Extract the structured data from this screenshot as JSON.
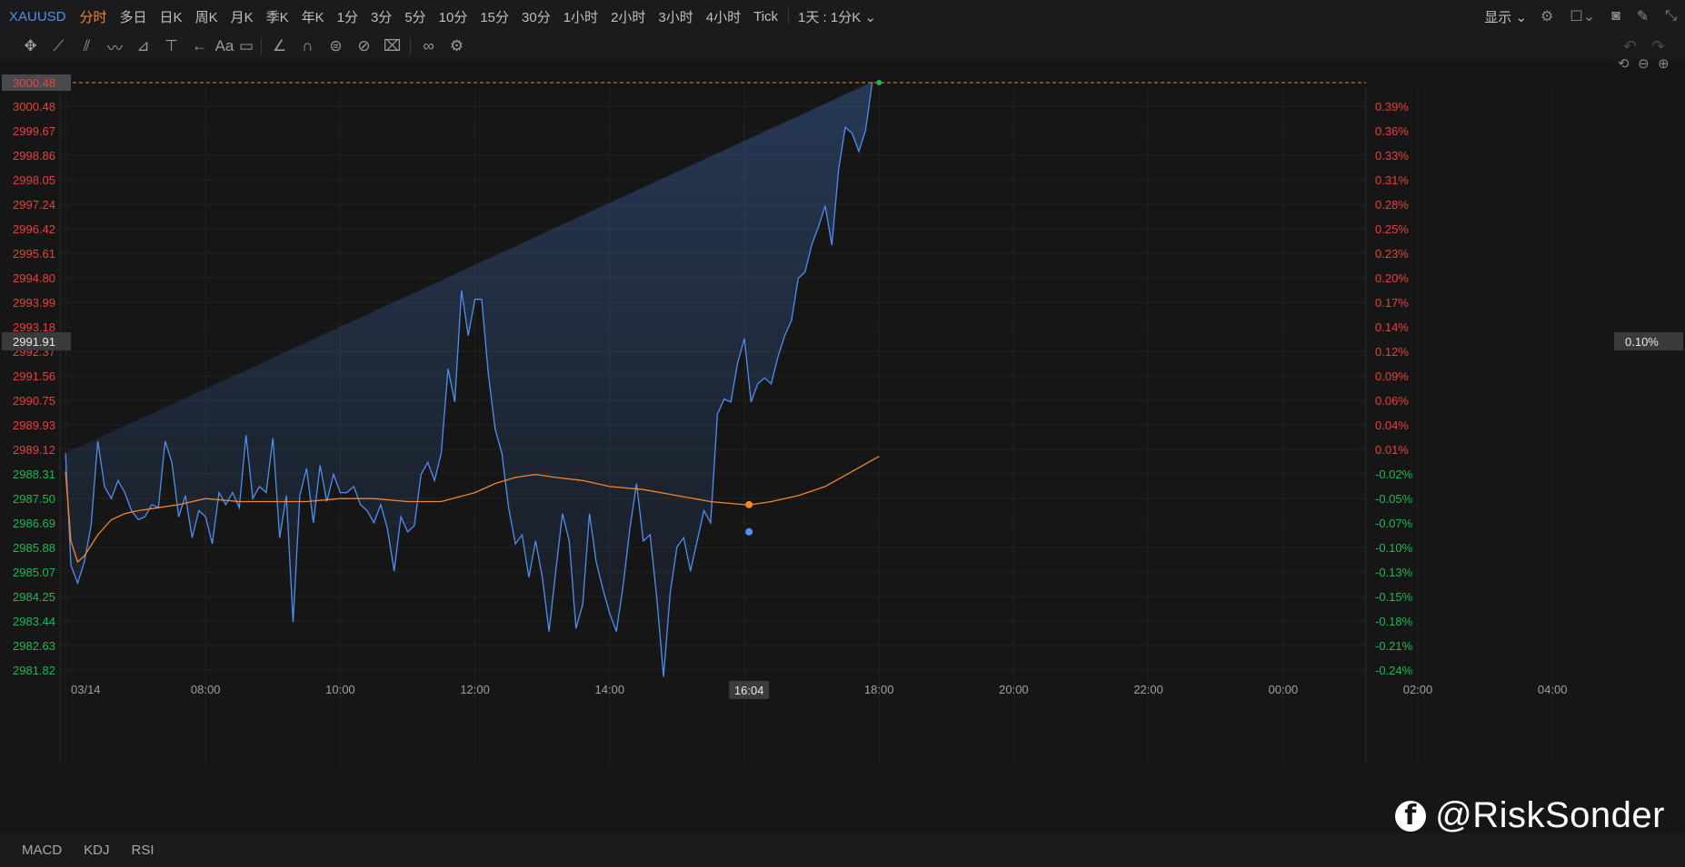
{
  "topbar": {
    "symbol": "XAUUSD",
    "timeframes": [
      {
        "label": "分时",
        "active": true
      },
      {
        "label": "多日"
      },
      {
        "label": "日K"
      },
      {
        "label": "周K"
      },
      {
        "label": "月K"
      },
      {
        "label": "季K"
      },
      {
        "label": "年K"
      },
      {
        "label": "1分"
      },
      {
        "label": "3分"
      },
      {
        "label": "5分"
      },
      {
        "label": "10分"
      },
      {
        "label": "15分"
      },
      {
        "label": "30分"
      },
      {
        "label": "1小时"
      },
      {
        "label": "2小时"
      },
      {
        "label": "3小时"
      },
      {
        "label": "4小时"
      },
      {
        "label": "Tick"
      }
    ],
    "period_dropdown": "1天 : 1分K",
    "display_label": "显示"
  },
  "indicators": [
    "MACD",
    "KDJ",
    "RSI"
  ],
  "watermark": {
    "text": "@RiskSonder",
    "icon": "facebook-icon"
  },
  "chart_data": {
    "type": "line",
    "instrument": "XAUUSD",
    "price_range": [
      2980.7,
      3001.1
    ],
    "pct_range": [
      -0.28,
      0.4
    ],
    "y_ticks_left": [
      "3000.48",
      "2999.67",
      "2998.86",
      "2998.05",
      "2997.24",
      "2996.42",
      "2995.61",
      "2994.80",
      "2993.99",
      "2993.18",
      "2992.37",
      "2991.56",
      "2990.75",
      "2989.93",
      "2989.12",
      "2988.31",
      "2987.50",
      "2986.69",
      "2985.88",
      "2985.07",
      "2984.25",
      "2983.44",
      "2982.63",
      "2981.82"
    ],
    "y_ticks_right": [
      "0.39%",
      "0.36%",
      "0.33%",
      "0.31%",
      "0.28%",
      "0.25%",
      "0.23%",
      "0.20%",
      "0.17%",
      "0.14%",
      "0.12%",
      "0.09%",
      "0.06%",
      "0.04%",
      "0.01%",
      "-0.02%",
      "-0.05%",
      "-0.07%",
      "-0.10%",
      "-0.13%",
      "-0.15%",
      "-0.18%",
      "-0.21%",
      "-0.24%"
    ],
    "up_color": "#e8413c",
    "down_color": "#1db954",
    "price_line_color": "#4f8ff0",
    "avg_line_color": "#f4852b",
    "x_ticks": [
      {
        "label": "03/14",
        "time": 5.92
      },
      {
        "label": "08:00",
        "time": 8.0
      },
      {
        "label": "10:00",
        "time": 10.0
      },
      {
        "label": "12:00",
        "time": 12.0
      },
      {
        "label": "14:00",
        "time": 14.0
      },
      {
        "label": "16:00",
        "time": 16.0
      },
      {
        "label": "18:00",
        "time": 18.0
      },
      {
        "label": "20:00",
        "time": 20.0
      },
      {
        "label": "22:00",
        "time": 22.0
      },
      {
        "label": "00:00",
        "time": 24.0
      },
      {
        "label": "02:00",
        "time": 26.0
      },
      {
        "label": "04:00",
        "time": 28.0
      }
    ],
    "time_range": [
      5.92,
      29.5
    ],
    "crosshair": {
      "time_label": "16:04",
      "time": 16.07,
      "price_label": "2991.91",
      "pct_label": "0.10%",
      "price": 2991.91
    },
    "last_price": {
      "label": "3000.48",
      "value": 3000.48,
      "time": 18.0
    },
    "price_series": {
      "name": "XAUUSD",
      "x": [
        5.92,
        6.0,
        6.1,
        6.2,
        6.3,
        6.4,
        6.5,
        6.6,
        6.7,
        6.8,
        6.9,
        7.0,
        7.1,
        7.2,
        7.3,
        7.4,
        7.5,
        7.6,
        7.7,
        7.8,
        7.9,
        8.0,
        8.1,
        8.2,
        8.3,
        8.4,
        8.5,
        8.6,
        8.7,
        8.8,
        8.9,
        9.0,
        9.1,
        9.2,
        9.3,
        9.4,
        9.5,
        9.6,
        9.7,
        9.8,
        9.9,
        10.0,
        10.1,
        10.2,
        10.3,
        10.4,
        10.5,
        10.6,
        10.7,
        10.8,
        10.9,
        11.0,
        11.1,
        11.2,
        11.3,
        11.4,
        11.5,
        11.6,
        11.7,
        11.8,
        11.9,
        12.0,
        12.1,
        12.2,
        12.3,
        12.4,
        12.5,
        12.6,
        12.7,
        12.8,
        12.9,
        13.0,
        13.1,
        13.2,
        13.3,
        13.4,
        13.5,
        13.6,
        13.7,
        13.8,
        13.9,
        14.0,
        14.1,
        14.2,
        14.3,
        14.4,
        14.5,
        14.6,
        14.7,
        14.8,
        14.9,
        15.0,
        15.1,
        15.2,
        15.3,
        15.4,
        15.5,
        15.6,
        15.7,
        15.8,
        15.9,
        16.0,
        16.1,
        16.2,
        16.3,
        16.4,
        16.5,
        16.6,
        16.7,
        16.8,
        16.9,
        17.0,
        17.1,
        17.2,
        17.3,
        17.4,
        17.5,
        17.6,
        17.7,
        17.8,
        17.9,
        18.0
      ],
      "values": [
        2988.2,
        2984.5,
        2983.9,
        2984.6,
        2985.8,
        2988.6,
        2987.1,
        2986.7,
        2987.3,
        2986.9,
        2986.3,
        2986.0,
        2986.1,
        2986.5,
        2986.4,
        2988.6,
        2987.9,
        2986.1,
        2986.8,
        2985.4,
        2986.3,
        2986.1,
        2985.2,
        2986.9,
        2986.5,
        2986.9,
        2986.4,
        2988.8,
        2986.7,
        2987.1,
        2986.9,
        2988.7,
        2985.4,
        2986.8,
        2982.6,
        2986.8,
        2987.7,
        2985.9,
        2987.8,
        2986.6,
        2987.5,
        2986.9,
        2986.9,
        2987.1,
        2986.5,
        2986.3,
        2985.9,
        2986.5,
        2985.7,
        2984.3,
        2986.1,
        2985.6,
        2985.8,
        2987.5,
        2987.9,
        2987.3,
        2988.2,
        2991.0,
        2989.9,
        2993.6,
        2992.1,
        2993.3,
        2993.3,
        2990.8,
        2989.0,
        2988.2,
        2986.4,
        2985.2,
        2985.5,
        2984.1,
        2985.3,
        2984.1,
        2982.3,
        2984.3,
        2986.2,
        2985.3,
        2982.4,
        2983.2,
        2986.2,
        2984.6,
        2983.7,
        2982.9,
        2982.3,
        2983.8,
        2985.7,
        2987.2,
        2985.3,
        2985.5,
        2983.4,
        2980.8,
        2983.6,
        2985.1,
        2985.4,
        2984.3,
        2985.3,
        2986.3,
        2985.9,
        2989.5,
        2990.0,
        2989.9,
        2991.2,
        2992.0,
        2989.9,
        2990.5,
        2990.7,
        2990.5,
        2991.4,
        2992.1,
        2992.6,
        2994.0,
        2994.2,
        2995.1,
        2995.7,
        2996.4,
        2995.1,
        2997.6,
        2999.0,
        2998.8,
        2998.2,
        2998.9,
        3000.5
      ]
    },
    "avg_series": {
      "name": "average",
      "x": [
        5.92,
        6.0,
        6.1,
        6.2,
        6.4,
        6.6,
        6.8,
        7.0,
        7.3,
        7.6,
        8.0,
        8.5,
        9.0,
        9.5,
        10.0,
        10.5,
        11.0,
        11.5,
        12.0,
        12.3,
        12.6,
        12.9,
        13.2,
        13.6,
        14.0,
        14.5,
        15.0,
        15.5,
        16.0,
        16.1,
        16.4,
        16.8,
        17.2,
        17.6,
        18.0
      ],
      "values": [
        2987.6,
        2985.3,
        2984.6,
        2984.8,
        2985.5,
        2986.0,
        2986.2,
        2986.3,
        2986.4,
        2986.5,
        2986.7,
        2986.6,
        2986.6,
        2986.6,
        2986.7,
        2986.7,
        2986.6,
        2986.6,
        2986.9,
        2987.2,
        2987.4,
        2987.5,
        2987.4,
        2987.3,
        2987.1,
        2987.0,
        2986.8,
        2986.6,
        2986.5,
        2986.5,
        2986.6,
        2986.8,
        2987.1,
        2987.6,
        2988.1
      ]
    },
    "grid": true
  }
}
